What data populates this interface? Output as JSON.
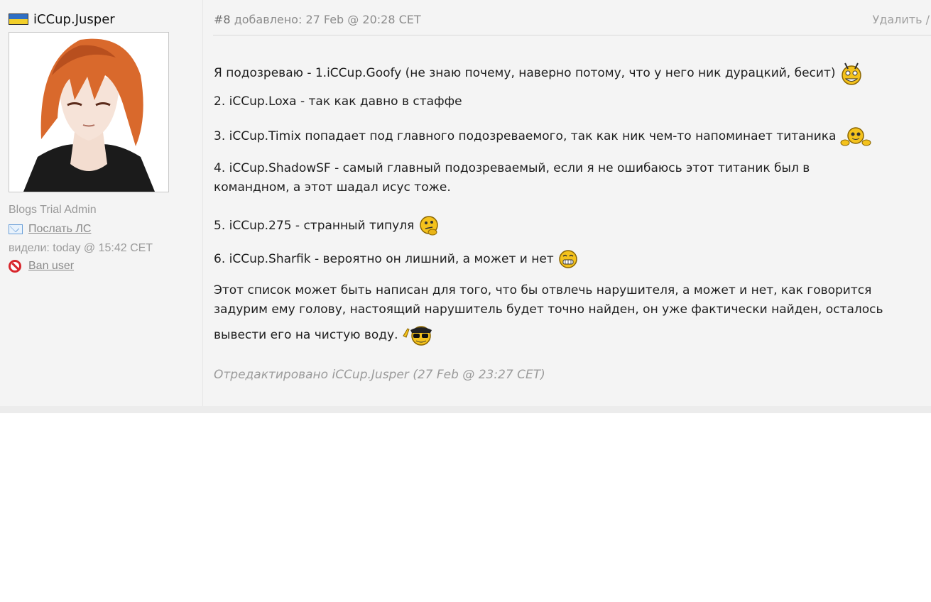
{
  "author": {
    "username": "iCCup.Jusper",
    "role": "Blogs Trial Admin",
    "send_pm_label": "Послать ЛС",
    "last_seen": "видели: today @ 15:42 CET",
    "ban_label": "Ban user"
  },
  "post": {
    "number": "#8",
    "added": "добавлено: 27 Feb @ 20:28 CET",
    "delete_label": "Удалить  /",
    "paragraphs": [
      "Я подозреваю - 1.iCCup.Goofy (не знаю почему, наверно потому, что у него ник дурацкий, бесит)",
      "2. iCCup.Loxa - так как давно в стаффе",
      "3. iCCup.Timix попадает под главного подозреваемого, так как ник чем-то напоминает титаника",
      "4. iCCup.ShadowSF - самый главный подозреваемый, если я не ошибаюсь этот титаник был в",
      "командном, а этот шадал исус тоже.",
      "5. iCCup.275 - странный типуля",
      "6. iCCup.Sharfik - вероятно он лишний, а может и нет",
      "Этот список может быть написан для того, что бы отвлечь нарушителя, а может и нет, как говорится",
      "задурим ему голову, настоящий нарушитель будет точно найден, он уже фактически найден, осталось",
      "вывести его на чистую воду."
    ],
    "edited_note": "Отредактировано iCCup.Jusper (27 Feb @ 23:27 CET)"
  },
  "icons": {
    "flag": "ukraine-flag-icon",
    "mail": "mail-icon",
    "ban": "ban-icon",
    "smileys": [
      "angry-smiley-icon",
      "peeking-smiley-icon",
      "thinking-smiley-icon",
      "grinning-smiley-icon",
      "sunglasses-smiley-icon"
    ]
  },
  "colors": {
    "background": "#f4f4f4",
    "muted_text": "#9a9a9a",
    "ban_red": "#d8262c",
    "flag_blue": "#2f6fc4",
    "flag_yellow": "#f2cf2a"
  }
}
